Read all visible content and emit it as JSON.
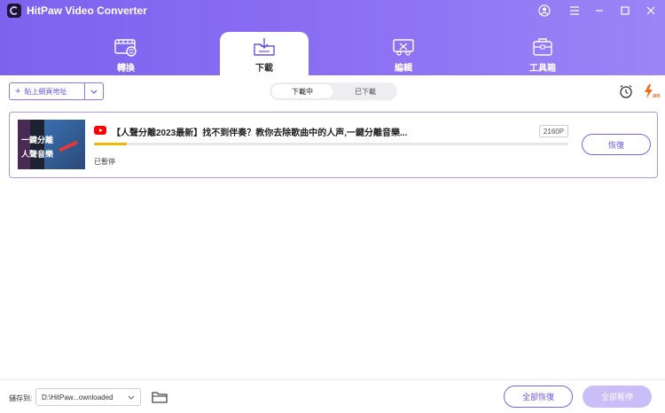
{
  "app": {
    "title": "HitPaw Video Converter"
  },
  "colors": {
    "accent": "#7c63ee",
    "progress": "#f2b705",
    "youtube": "#ff0000"
  },
  "nav": {
    "tabs": [
      {
        "label": "轉換",
        "icon": "convert-icon",
        "active": false
      },
      {
        "label": "下載",
        "icon": "download-icon",
        "active": true
      },
      {
        "label": "編輯",
        "icon": "edit-icon",
        "active": false
      },
      {
        "label": "工具箱",
        "icon": "toolbox-icon",
        "active": false
      }
    ]
  },
  "toolbar": {
    "paste_label": "貼上網頁地址",
    "segment": {
      "downloading": "下載中",
      "downloaded": "已下載"
    }
  },
  "download": {
    "title": "【人聲分離2023最新】找不到伴奏？教你去除歌曲中的人声,一鍵分離音樂...",
    "thumbnail_line1": "一鍵分離",
    "thumbnail_line2": "人聲音樂",
    "resolution": "2160P",
    "status": "已暫停",
    "progress": 0.07,
    "resume_label": "恢復"
  },
  "footer": {
    "save_label": "儲存到:",
    "path": "D:\\HitPaw...ownloaded",
    "resume_all_label": "全部恢復",
    "pause_all_label": "全部暫停"
  }
}
